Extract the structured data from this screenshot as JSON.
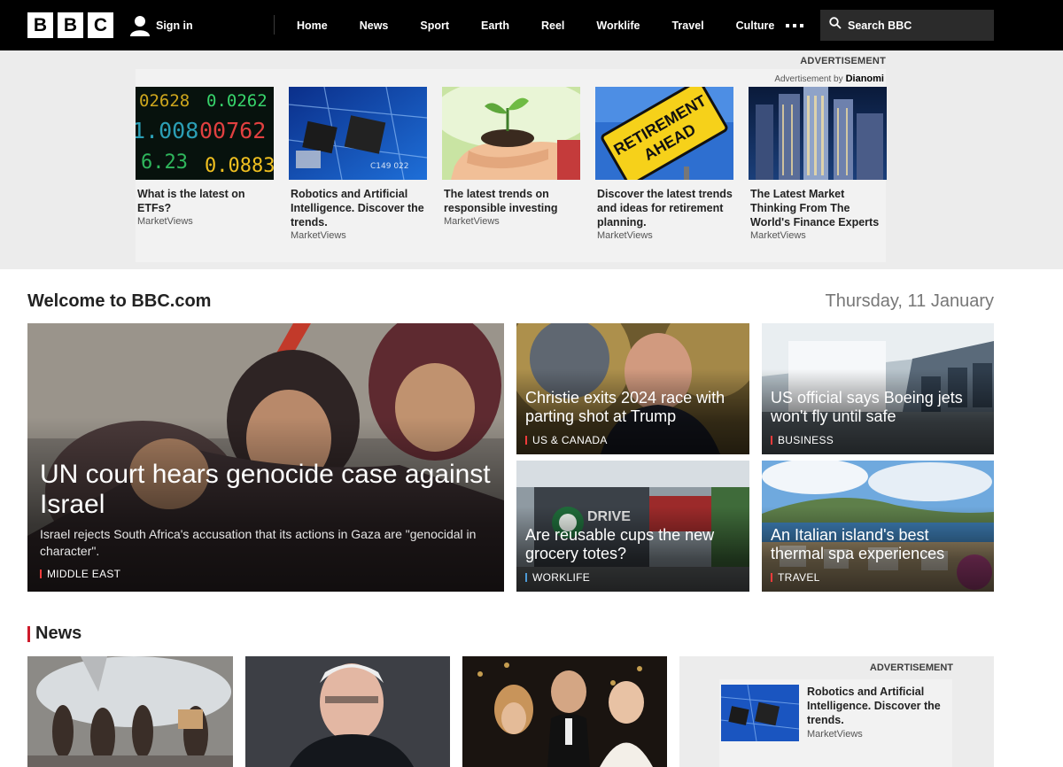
{
  "header": {
    "logo_letters": [
      "B",
      "B",
      "C"
    ],
    "sign_in": "Sign in",
    "nav": [
      "Home",
      "News",
      "Sport",
      "Earth",
      "Reel",
      "Worklife",
      "Travel",
      "Culture"
    ],
    "search_placeholder": "Search BBC",
    "icons": {
      "user": "user-icon",
      "more": "more-dots-icon",
      "search": "search-icon"
    }
  },
  "advert_band": {
    "label": "ADVERTISEMENT",
    "by_prefix": "Advertisement by",
    "by_brand": "Dianomi",
    "cards": [
      {
        "title": "What is the latest on ETFs?",
        "source": "MarketViews",
        "image": "stock-ticker-board"
      },
      {
        "title": "Robotics and Artificial Intelligence. Discover the trends.",
        "source": "MarketViews",
        "image": "circuit-board-chip"
      },
      {
        "title": "The latest trends on responsible investing",
        "source": "MarketViews",
        "image": "hands-holding-seedling"
      },
      {
        "title": "Discover the latest trends and ideas for retirement planning.",
        "source": "MarketViews",
        "image": "retirement-ahead-sign"
      },
      {
        "title": "The Latest Market Thinking From The World's Finance Experts",
        "source": "MarketViews",
        "image": "city-skyscrapers-night"
      }
    ]
  },
  "welcome": {
    "title": "Welcome to BBC.com",
    "date": "Thursday, 11 January"
  },
  "top_stories": {
    "lead": {
      "headline": "UN court hears genocide case against Israel",
      "summary": "Israel rejects South Africa's accusation that its actions in Gaza are \"genocidal in character\".",
      "tag": "MIDDLE EAST"
    },
    "items": [
      {
        "headline": "Christie exits 2024 race with parting shot at Trump",
        "tag": "US & CANADA"
      },
      {
        "headline": "US official says Boeing jets won't fly until safe",
        "tag": "BUSINESS"
      },
      {
        "headline": "Are reusable cups the new grocery totes?",
        "tag": "WORKLIFE"
      },
      {
        "headline": "An Italian island's best thermal spa experiences",
        "tag": "TRAVEL"
      }
    ]
  },
  "news_section": {
    "title": "News"
  },
  "advert_side": {
    "label": "ADVERTISEMENT",
    "card": {
      "title": "Robotics and Artificial Intelligence. Discover the trends.",
      "source": "MarketViews"
    }
  }
}
